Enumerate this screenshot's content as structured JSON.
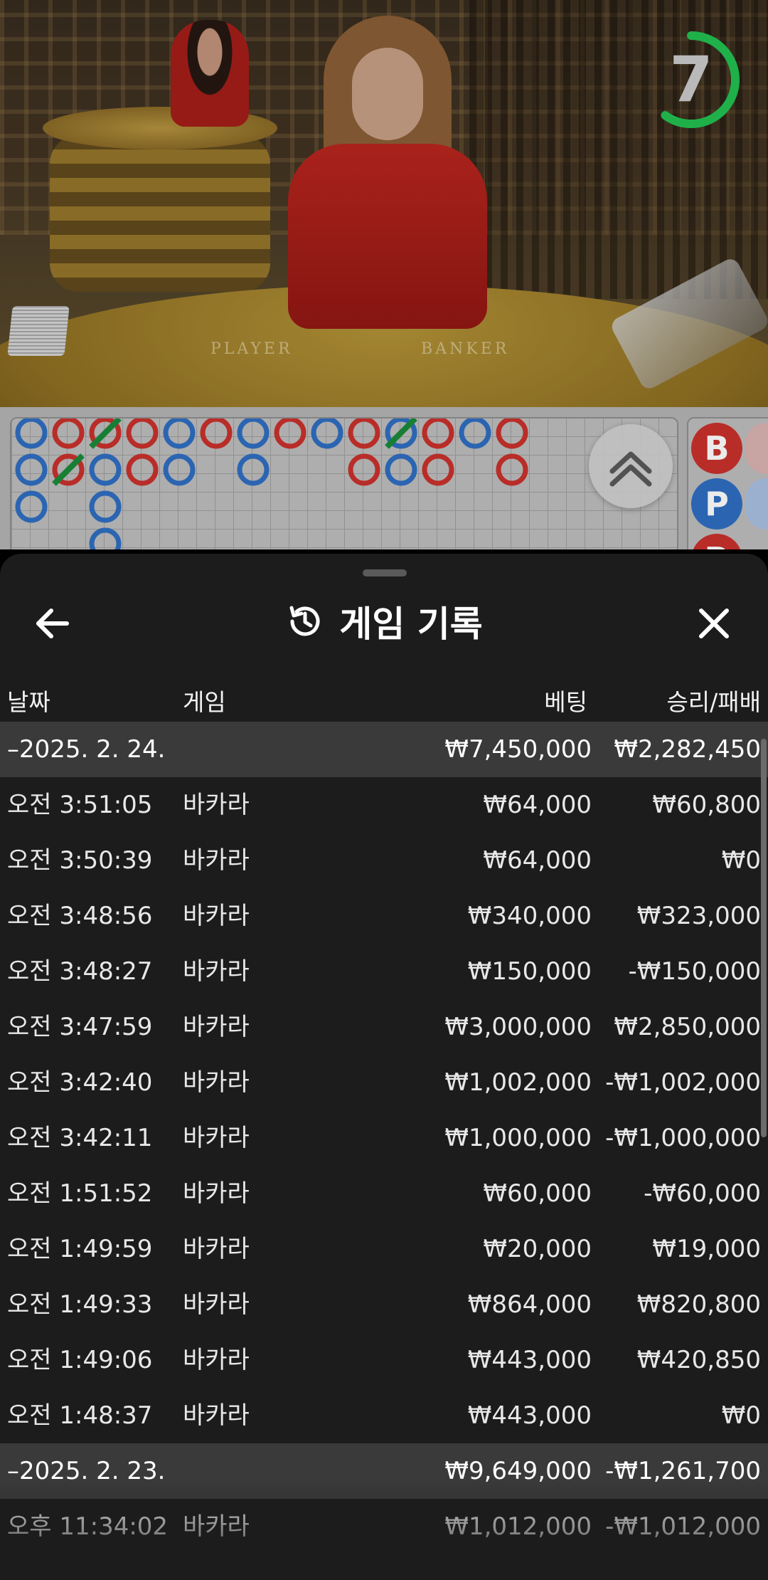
{
  "video": {
    "table_labels": {
      "player": "PLAYER",
      "banker": "BANKER"
    },
    "timer": {
      "seconds": "7",
      "progress": 0.6,
      "color": "#1fb04a"
    }
  },
  "roadmap": {
    "predict_buttons": [
      {
        "label": "B",
        "color": "#c9312c"
      },
      {
        "label": "P",
        "color": "#2f6ec2"
      },
      {
        "label": "B",
        "color": "#c9312c"
      }
    ],
    "colors": {
      "banker": "#c9312c",
      "player": "#2f6ec2",
      "tie": "#1a8a3a"
    }
  },
  "sheet": {
    "title": "게임 기록",
    "icons": {
      "back": "arrow-left-icon",
      "title": "history-icon",
      "close": "close-icon",
      "scroll_up": "chevrons-up-icon"
    },
    "columns": {
      "date": "날짜",
      "game": "게임",
      "bet": "베팅",
      "result": "승리/패배"
    },
    "groups": [
      {
        "date": "–2025. 2. 24.",
        "bet": "₩7,450,000",
        "result": "₩2,282,450",
        "rows": [
          {
            "time": "오전 3:51:05",
            "game": "바카라",
            "bet": "₩64,000",
            "result": "₩60,800"
          },
          {
            "time": "오전 3:50:39",
            "game": "바카라",
            "bet": "₩64,000",
            "result": "₩0"
          },
          {
            "time": "오전 3:48:56",
            "game": "바카라",
            "bet": "₩340,000",
            "result": "₩323,000"
          },
          {
            "time": "오전 3:48:27",
            "game": "바카라",
            "bet": "₩150,000",
            "result": "-₩150,000"
          },
          {
            "time": "오전 3:47:59",
            "game": "바카라",
            "bet": "₩3,000,000",
            "result": "₩2,850,000"
          },
          {
            "time": "오전 3:42:40",
            "game": "바카라",
            "bet": "₩1,002,000",
            "result": "-₩1,002,000"
          },
          {
            "time": "오전 3:42:11",
            "game": "바카라",
            "bet": "₩1,000,000",
            "result": "-₩1,000,000"
          },
          {
            "time": "오전 1:51:52",
            "game": "바카라",
            "bet": "₩60,000",
            "result": "-₩60,000"
          },
          {
            "time": "오전 1:49:59",
            "game": "바카라",
            "bet": "₩20,000",
            "result": "₩19,000"
          },
          {
            "time": "오전 1:49:33",
            "game": "바카라",
            "bet": "₩864,000",
            "result": "₩820,800"
          },
          {
            "time": "오전 1:49:06",
            "game": "바카라",
            "bet": "₩443,000",
            "result": "₩420,850"
          },
          {
            "time": "오전 1:48:37",
            "game": "바카라",
            "bet": "₩443,000",
            "result": "₩0"
          }
        ]
      },
      {
        "date": "–2025. 2. 23.",
        "bet": "₩9,649,000",
        "result": "-₩1,261,700",
        "rows": [
          {
            "time": "오후 11:34:02",
            "game": "바카라",
            "bet": "₩1,012,000",
            "result": "-₩1,012,000"
          }
        ]
      }
    ]
  }
}
